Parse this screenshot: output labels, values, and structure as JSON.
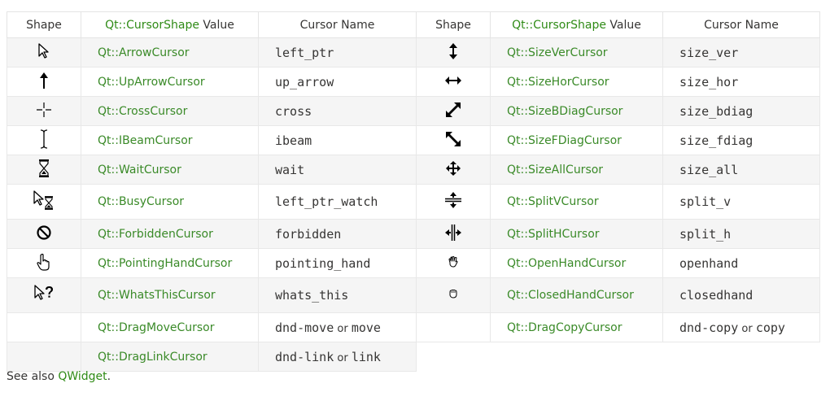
{
  "headers": {
    "shape": "Shape",
    "value_prefix": "Qt::CursorShape",
    "value_suffix": " Value",
    "cursor_name": "Cursor Name"
  },
  "rows": [
    {
      "l_icon": "arrow-cursor-icon",
      "l_value": "Qt::ArrowCursor",
      "l_name": "left_ptr",
      "r_icon": "size-ver-cursor-icon",
      "r_value": "Qt::SizeVerCursor",
      "r_name": "size_ver"
    },
    {
      "l_icon": "up-arrow-cursor-icon",
      "l_value": "Qt::UpArrowCursor",
      "l_name": "up_arrow",
      "r_icon": "size-hor-cursor-icon",
      "r_value": "Qt::SizeHorCursor",
      "r_name": "size_hor"
    },
    {
      "l_icon": "cross-cursor-icon",
      "l_value": "Qt::CrossCursor",
      "l_name": "cross",
      "r_icon": "size-bdiag-cursor-icon",
      "r_value": "Qt::SizeBDiagCursor",
      "r_name": "size_bdiag"
    },
    {
      "l_icon": "ibeam-cursor-icon",
      "l_value": "Qt::IBeamCursor",
      "l_name": "ibeam",
      "r_icon": "size-fdiag-cursor-icon",
      "r_value": "Qt::SizeFDiagCursor",
      "r_name": "size_fdiag"
    },
    {
      "l_icon": "wait-cursor-icon",
      "l_value": "Qt::WaitCursor",
      "l_name": "wait",
      "r_icon": "size-all-cursor-icon",
      "r_value": "Qt::SizeAllCursor",
      "r_name": "size_all"
    },
    {
      "l_icon": "busy-cursor-icon",
      "l_value": "Qt::BusyCursor",
      "l_name": "left_ptr_watch",
      "r_icon": "split-v-cursor-icon",
      "r_value": "Qt::SplitVCursor",
      "r_name": "split_v"
    },
    {
      "l_icon": "forbidden-cursor-icon",
      "l_value": "Qt::ForbiddenCursor",
      "l_name": "forbidden",
      "r_icon": "split-h-cursor-icon",
      "r_value": "Qt::SplitHCursor",
      "r_name": "split_h"
    },
    {
      "l_icon": "pointing-hand-cursor-icon",
      "l_value": "Qt::PointingHandCursor",
      "l_name": "pointing_hand",
      "r_icon": "open-hand-cursor-icon",
      "r_value": "Qt::OpenHandCursor",
      "r_name": "openhand"
    },
    {
      "l_icon": "whats-this-cursor-icon",
      "l_value": "Qt::WhatsThisCursor",
      "l_name": "whats_this",
      "r_icon": "closed-hand-cursor-icon",
      "r_value": "Qt::ClosedHandCursor",
      "r_name": "closedhand"
    }
  ],
  "drag_move": {
    "value": "Qt::DragMoveCursor",
    "name_a": "dnd-move",
    "or": " or ",
    "name_b": "move"
  },
  "drag_copy": {
    "value": "Qt::DragCopyCursor",
    "name_a": "dnd-copy",
    "or": " or ",
    "name_b": "copy"
  },
  "drag_link": {
    "value": "Qt::DragLinkCursor",
    "name_a": "dnd-link",
    "or": " or ",
    "name_b": "link"
  },
  "see_also": {
    "prefix": "See also ",
    "link": "QWidget",
    "suffix": "."
  }
}
